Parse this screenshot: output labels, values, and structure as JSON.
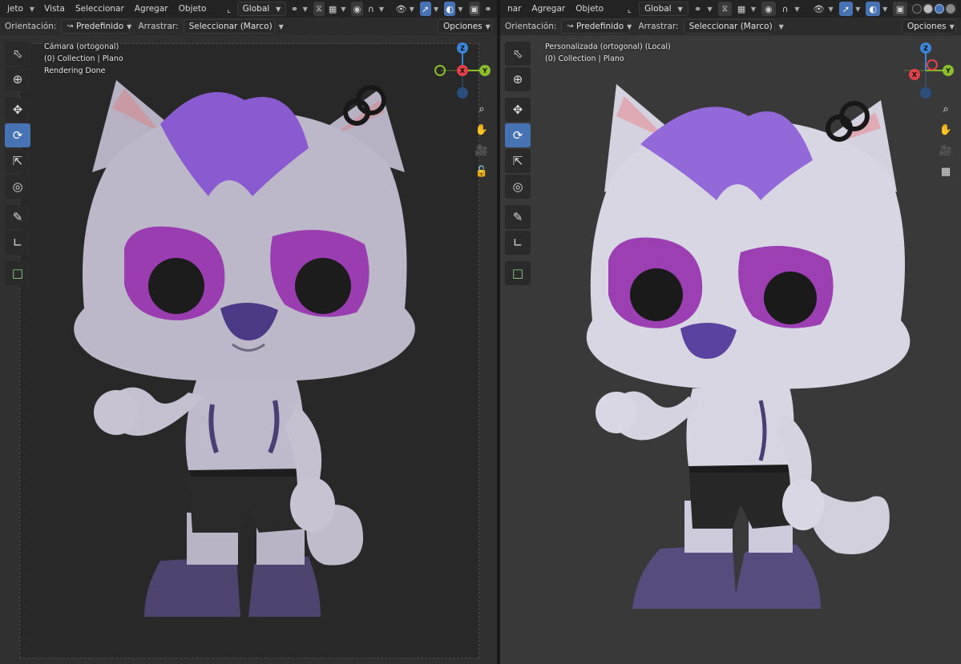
{
  "left": {
    "header": {
      "menus": [
        "jeto",
        "Vista",
        "Seleccionar",
        "Agregar",
        "Objeto"
      ],
      "transform_orientation": "Global"
    },
    "tool_header": {
      "orientation_label": "Orientación:",
      "orientation_value": "Predefinido",
      "drag_label": "Arrastrar:",
      "drag_value": "Seleccionar (Marco)",
      "options_label": "Opciones"
    },
    "overlay": {
      "view_name": "Cámara (ortogonal)",
      "collection": "(0) Collection | Plano",
      "status": "Rendering Done"
    }
  },
  "right": {
    "header": {
      "menus": [
        "nar",
        "Agregar",
        "Objeto"
      ],
      "transform_orientation": "Global"
    },
    "tool_header": {
      "orientation_label": "Orientación:",
      "orientation_value": "Predefinido",
      "drag_label": "Arrastrar:",
      "drag_value": "Seleccionar (Marco)",
      "options_label": "Opciones"
    },
    "overlay": {
      "view_name": "Personalizada (ortogonal) (Local)",
      "collection": "(0) Collection | Plano"
    }
  },
  "gizmo": {
    "x": "X",
    "y": "Y",
    "z": "Z"
  },
  "colors": {
    "x_axis": "#e3404a",
    "y_axis": "#8bbd2c",
    "z_axis": "#3c84d6",
    "active_tool": "#4772b3",
    "fur": "#b9b5c6",
    "hair": "#8a5ad0",
    "eye_patch": "#9a3db0",
    "shorts": "#2a2a2a",
    "boots": "#4f4470"
  },
  "tools": [
    "select-box-icon",
    "cursor-icon",
    "move-icon",
    "rotate-icon",
    "scale-icon",
    "transform-icon",
    "annotate-icon",
    "measure-icon",
    "add-cube-icon"
  ]
}
